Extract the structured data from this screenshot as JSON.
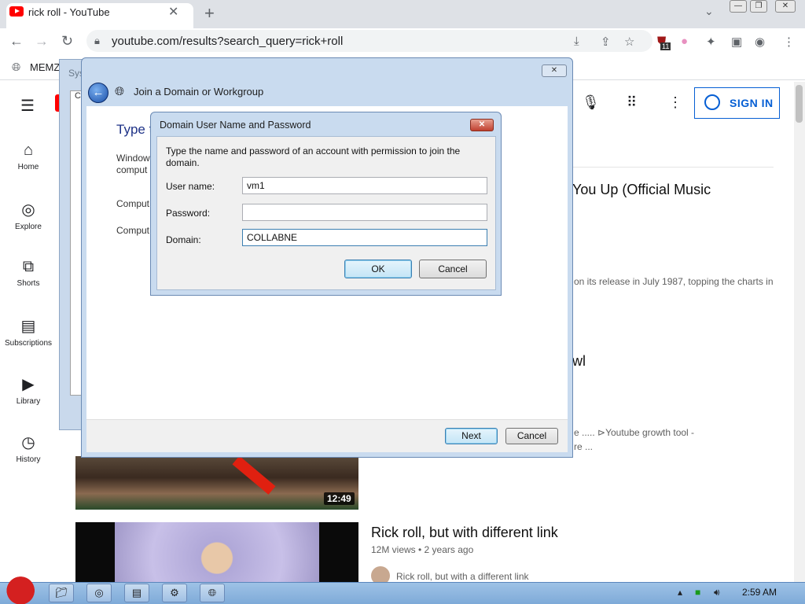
{
  "browser": {
    "tab_title": "rick roll - YouTube",
    "url": "youtube.com/results?search_query=rick+roll",
    "bookmark_label": "MEMZ",
    "extension_badge": "11"
  },
  "youtube": {
    "sidebar": [
      {
        "label": "Home",
        "icon": "home-icon"
      },
      {
        "label": "Explore",
        "icon": "compass-icon"
      },
      {
        "label": "Shorts",
        "icon": "shorts-icon"
      },
      {
        "label": "Subscriptions",
        "icon": "subscriptions-icon"
      },
      {
        "label": "Library",
        "icon": "library-icon"
      },
      {
        "label": "History",
        "icon": "history-icon"
      }
    ],
    "signin_label": "SIGN IN",
    "results": [
      {
        "title_fragment": "You Up (Official Music",
        "desc_fragment": "on its release in July 1987, topping the charts in"
      },
      {
        "title_fragment": "wl",
        "desc_line1": "e ..... ⊳Youtube growth tool -",
        "desc_line2": "re ...",
        "duration": "12:49"
      },
      {
        "title": "Rick roll, but with different link",
        "meta": "12M views • 2 years ago",
        "channel_line": "Rick roll, but with a different link"
      }
    ]
  },
  "system_properties": {
    "title_fragment": "Sys",
    "inner_fragment": "C"
  },
  "join_domain": {
    "title": "Join a Domain or Workgroup",
    "heading_fragment": "Type t",
    "text_line1": "Window",
    "text_line2": "comput",
    "label1_fragment": "Comput",
    "label2_fragment": "Comput",
    "next_label": "Next",
    "cancel_label": "Cancel"
  },
  "credentials": {
    "title": "Domain User Name and Password",
    "description": "Type the name and password of an account with permission to join the domain.",
    "username_label": "User name:",
    "username_value": "vm1",
    "password_label": "Password:",
    "password_value": "",
    "domain_label": "Domain:",
    "domain_value": "COLLABNE",
    "ok_label": "OK",
    "cancel_label": "Cancel"
  },
  "taskbar": {
    "clock": "2:59 AM"
  }
}
